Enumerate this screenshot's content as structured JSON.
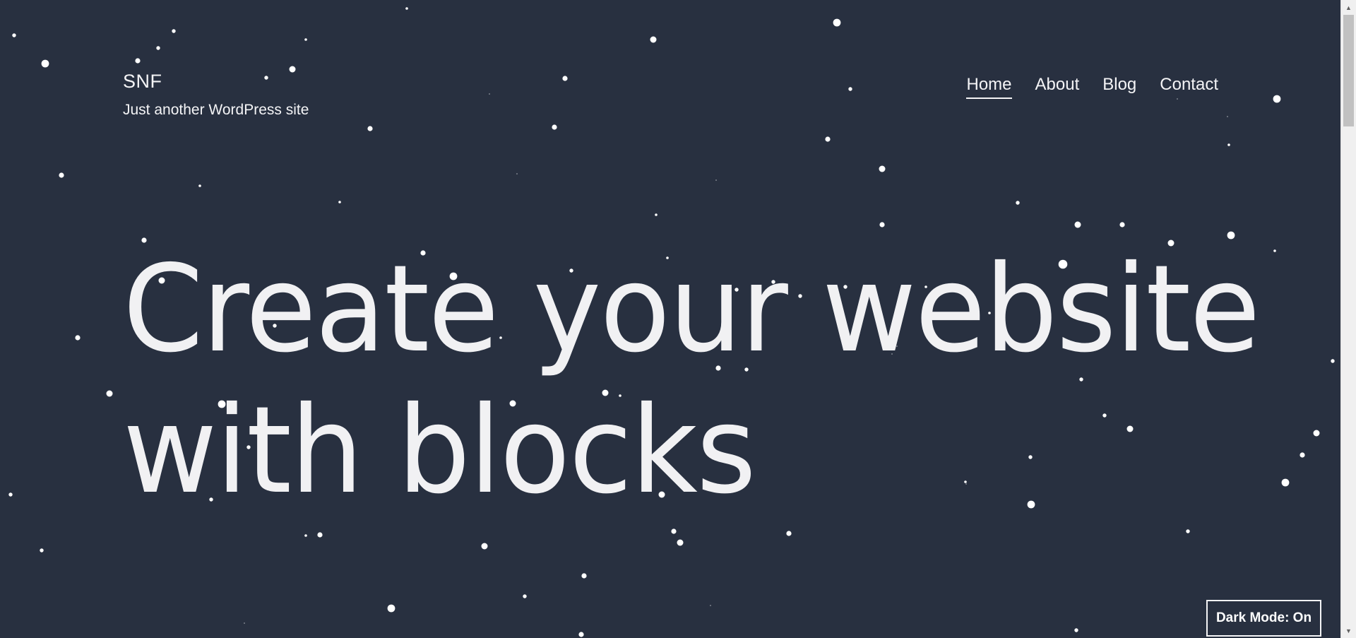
{
  "site": {
    "title": "SNF",
    "tagline": "Just another WordPress site"
  },
  "nav": {
    "items": [
      {
        "label": "Home",
        "active": true
      },
      {
        "label": "About",
        "active": false
      },
      {
        "label": "Blog",
        "active": false
      },
      {
        "label": "Contact",
        "active": false
      }
    ]
  },
  "hero": {
    "line1": "Create your website",
    "line2": "with blocks"
  },
  "dark_mode": {
    "label": "Dark Mode: On"
  },
  "colors": {
    "background": "#283040",
    "text": "#f4f4f6",
    "snow": "#ffffff"
  },
  "scrollbar": {
    "up_icon": "scroll-up-arrow-icon",
    "down_icon": "scroll-down-arrow-icon"
  }
}
